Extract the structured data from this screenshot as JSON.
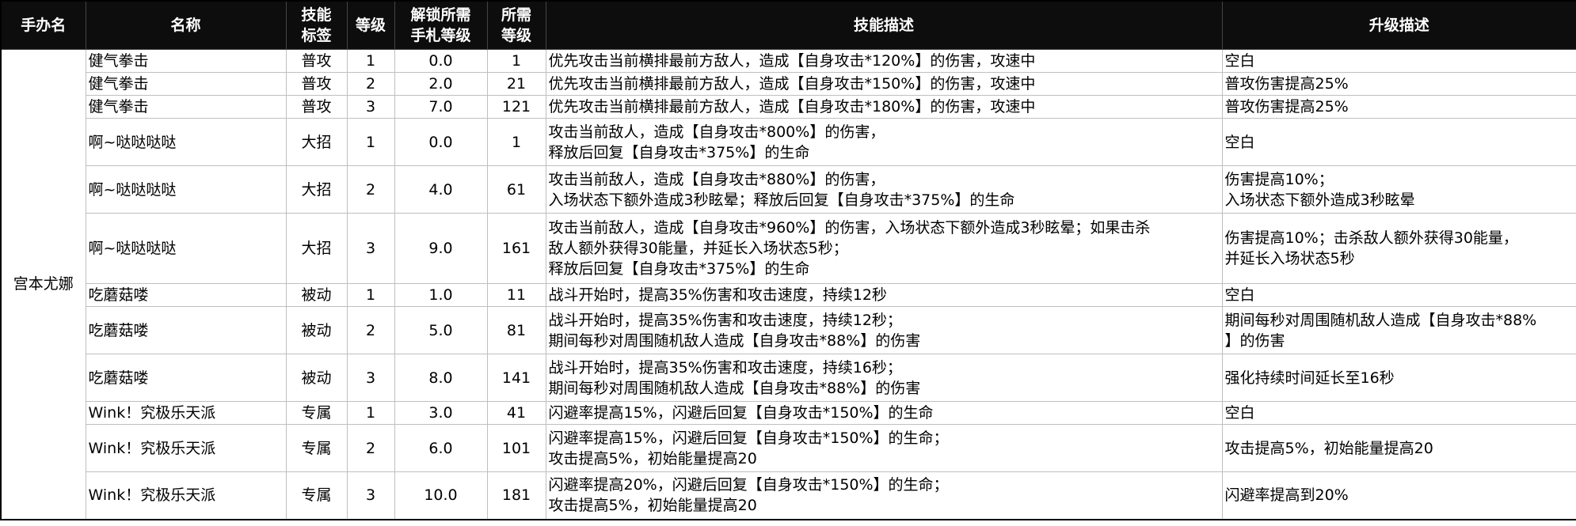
{
  "headers": {
    "hero": "手办名",
    "name": "名称",
    "tag": "技能\n标签",
    "level": "等级",
    "unlock": "解锁所需\n手札等级",
    "req": "所需\n等级",
    "desc": "技能描述",
    "upgrade": "升级描述"
  },
  "hero": "宫本尤娜",
  "rows": [
    {
      "name": "健气拳击",
      "tag": "普攻",
      "level": "1",
      "unlock": "0.0",
      "req": "1",
      "desc": "优先攻击当前横排最前方敌人，造成【自身攻击*120%】的伤害，攻速中",
      "upgrade": "空白"
    },
    {
      "name": "健气拳击",
      "tag": "普攻",
      "level": "2",
      "unlock": "2.0",
      "req": "21",
      "desc": "优先攻击当前横排最前方敌人，造成【自身攻击*150%】的伤害，攻速中",
      "upgrade": "普攻伤害提高25%"
    },
    {
      "name": "健气拳击",
      "tag": "普攻",
      "level": "3",
      "unlock": "7.0",
      "req": "121",
      "desc": "优先攻击当前横排最前方敌人，造成【自身攻击*180%】的伤害，攻速中",
      "upgrade": "普攻伤害提高25%"
    },
    {
      "name": "啊~哒哒哒哒",
      "tag": "大招",
      "level": "1",
      "unlock": "0.0",
      "req": "1",
      "desc": "攻击当前敌人，造成【自身攻击*800%】的伤害，\n释放后回复【自身攻击*375%】的生命",
      "upgrade": "空白"
    },
    {
      "name": "啊~哒哒哒哒",
      "tag": "大招",
      "level": "2",
      "unlock": "4.0",
      "req": "61",
      "desc": "攻击当前敌人，造成【自身攻击*880%】的伤害，\n入场状态下额外造成3秒眩晕；释放后回复【自身攻击*375%】的生命",
      "upgrade": "伤害提高10%；\n入场状态下额外造成3秒眩晕"
    },
    {
      "name": "啊~哒哒哒哒",
      "tag": "大招",
      "level": "3",
      "unlock": "9.0",
      "req": "161",
      "desc": "攻击当前敌人，造成【自身攻击*960%】的伤害，入场状态下额外造成3秒眩晕；如果击杀\n敌人额外获得30能量，并延长入场状态5秒；\n释放后回复【自身攻击*375%】的生命",
      "upgrade": "伤害提高10%；击杀敌人额外获得30能量，\n并延长入场状态5秒"
    },
    {
      "name": "吃蘑菇喽",
      "tag": "被动",
      "level": "1",
      "unlock": "1.0",
      "req": "11",
      "desc": "战斗开始时，提高35%伤害和攻击速度，持续12秒",
      "upgrade": "空白"
    },
    {
      "name": "吃蘑菇喽",
      "tag": "被动",
      "level": "2",
      "unlock": "5.0",
      "req": "81",
      "desc": "战斗开始时，提高35%伤害和攻击速度，持续12秒；\n期间每秒对周围随机敌人造成【自身攻击*88%】的伤害",
      "upgrade": "期间每秒对周围随机敌人造成【自身攻击*88%\n】的伤害"
    },
    {
      "name": "吃蘑菇喽",
      "tag": "被动",
      "level": "3",
      "unlock": "8.0",
      "req": "141",
      "desc": "战斗开始时，提高35%伤害和攻击速度，持续16秒；\n期间每秒对周围随机敌人造成【自身攻击*88%】的伤害",
      "upgrade": "强化持续时间延长至16秒"
    },
    {
      "name": "Wink！究极乐天派",
      "tag": "专属",
      "level": "1",
      "unlock": "3.0",
      "req": "41",
      "desc": "闪避率提高15%，闪避后回复【自身攻击*150%】的生命",
      "upgrade": "空白"
    },
    {
      "name": "Wink！究极乐天派",
      "tag": "专属",
      "level": "2",
      "unlock": "6.0",
      "req": "101",
      "desc": "闪避率提高15%，闪避后回复【自身攻击*150%】的生命；\n攻击提高5%，初始能量提高20",
      "upgrade": "攻击提高5%，初始能量提高20"
    },
    {
      "name": "Wink！究极乐天派",
      "tag": "专属",
      "level": "3",
      "unlock": "10.0",
      "req": "181",
      "desc": "闪避率提高20%，闪避后回复【自身攻击*150%】的生命；\n攻击提高5%，初始能量提高20",
      "upgrade": "闪避率提高到20%"
    }
  ]
}
